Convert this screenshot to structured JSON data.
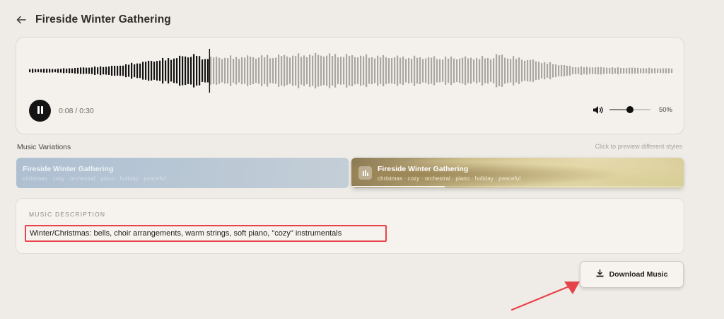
{
  "header": {
    "title": "Fireside Winter Gathering"
  },
  "player": {
    "time": "0:08 / 0:30",
    "progress_fraction": 0.28,
    "volume_percent": 50,
    "volume_label": "50%"
  },
  "variations": {
    "label": "Music Variations",
    "hint": "Click to preview different styles",
    "items": [
      {
        "title": "Fireside Winter Gathering",
        "tags": "christmas · cozy · orchestral · piano · holiday · peaceful",
        "playback_progress": 0
      },
      {
        "title": "Fireside Winter Gathering",
        "tags": "christmas · cozy · orchestral · piano · holiday · peaceful",
        "playback_progress": 0.28
      }
    ]
  },
  "description": {
    "label": "MUSIC DESCRIPTION",
    "text": "Winter/Christmas: bells, choir arrangements, warm strings, soft piano, \"cozy\" instrumentals"
  },
  "download": {
    "label": "Download Music"
  },
  "colors": {
    "background": "#efece7",
    "played": "#141414",
    "unplayed": "#aaa7a2",
    "annotation": "#e7434b"
  },
  "icons": {
    "back": "arrow-left-icon",
    "play_state": "pause-icon",
    "volume": "speaker-icon",
    "variation": "audio-bars-icon",
    "download": "download-icon"
  }
}
